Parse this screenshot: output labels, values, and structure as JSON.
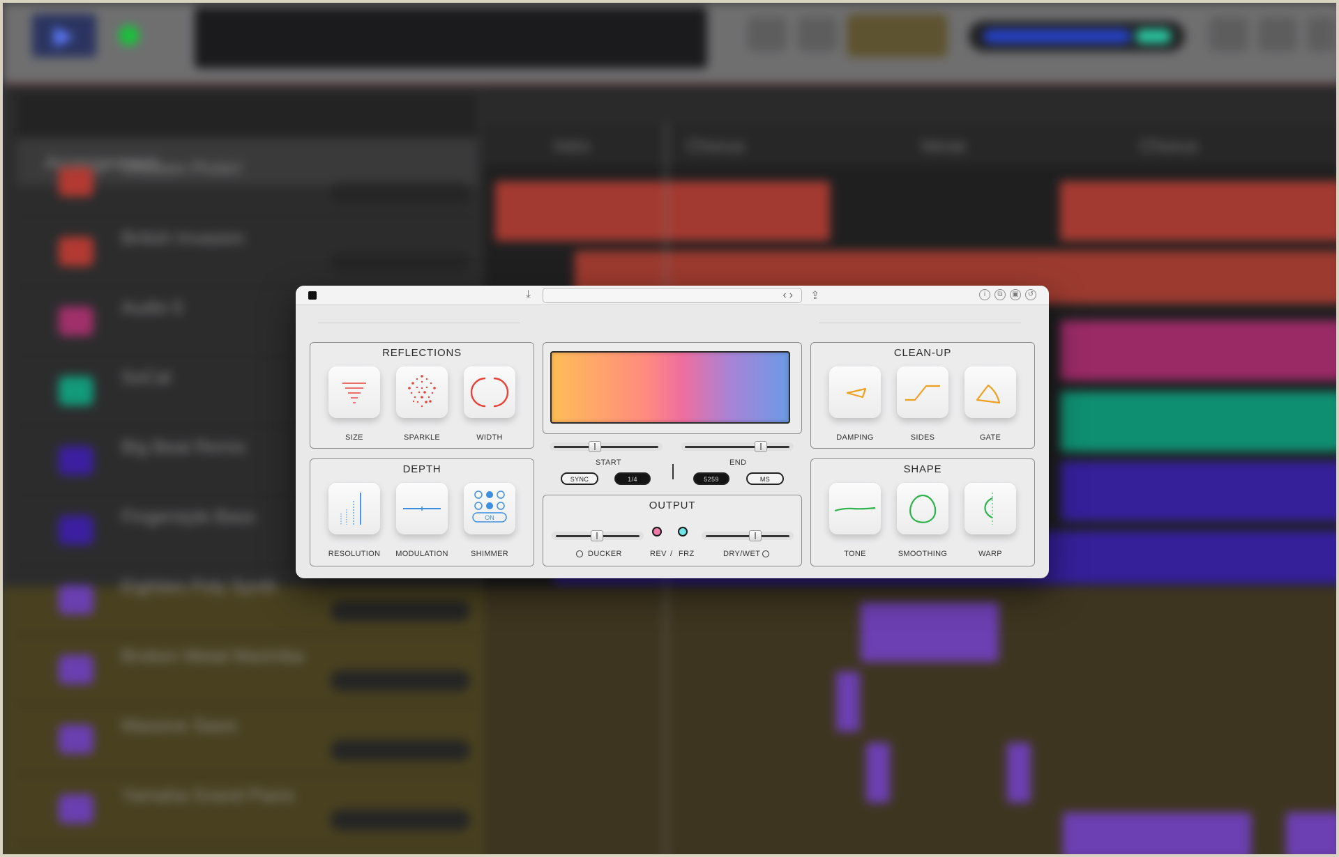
{
  "daw": {
    "arrangement_label": "Arrangement",
    "markers": [
      "Intro",
      "Chorus",
      "Verse",
      "Chorus"
    ],
    "tracks": [
      {
        "name": "Chicken Pickin'",
        "color": "#b23a32"
      },
      {
        "name": "British Invasion",
        "color": "#b23a32"
      },
      {
        "name": "Audio 5",
        "color": "#a0306a"
      },
      {
        "name": "SoCal",
        "color": "#129a7a"
      },
      {
        "name": "Big Beat Remix",
        "color": "#3b1fa0"
      },
      {
        "name": "Fingerstyle Bass",
        "color": "#3b1fa0"
      },
      {
        "name": "Eighties Poly Synth",
        "color": "#6a3fb0"
      },
      {
        "name": "Broken Metal Marimba",
        "color": "#6a3fb0"
      },
      {
        "name": "Massive Saws",
        "color": "#6a3fb0"
      },
      {
        "name": "Yamaha Grand Piano",
        "color": "#6a3fb0"
      }
    ]
  },
  "plugin": {
    "reflections": {
      "title": "REFLECTIONS",
      "knobs": [
        {
          "label": "SIZE",
          "icon": "size-icon"
        },
        {
          "label": "SPARKLE",
          "icon": "sparkle-icon"
        },
        {
          "label": "WIDTH",
          "icon": "width-icon"
        }
      ]
    },
    "depth": {
      "title": "DEPTH",
      "knobs": [
        {
          "label": "RESOLUTION",
          "icon": "resolution-icon"
        },
        {
          "label": "MODULATION",
          "icon": "modulation-icon"
        },
        {
          "label": "SHIMMER",
          "icon": "shimmer-icon",
          "badge": "ON"
        }
      ]
    },
    "cleanup": {
      "title": "CLEAN-UP",
      "knobs": [
        {
          "label": "DAMPING",
          "icon": "damping-icon"
        },
        {
          "label": "SIDES",
          "icon": "sides-icon"
        },
        {
          "label": "GATE",
          "icon": "gate-icon"
        }
      ]
    },
    "shape": {
      "title": "SHAPE",
      "knobs": [
        {
          "label": "TONE",
          "icon": "tone-icon"
        },
        {
          "label": "SMOOTHING",
          "icon": "smoothing-icon"
        },
        {
          "label": "WARP",
          "icon": "warp-icon"
        }
      ]
    },
    "center": {
      "start_label": "START",
      "end_label": "END",
      "sync_label": "SYNC",
      "division_value": "1/4",
      "ms_value": "5259",
      "ms_label": "MS"
    },
    "output": {
      "title": "OUTPUT",
      "ducker_label": "DUCKER",
      "rev_label": "REV",
      "slash": "/",
      "frz_label": "FRZ",
      "drywet_label": "DRY/WET"
    },
    "colors": {
      "accent_red": "#e8433a",
      "accent_blue": "#3b8ee0",
      "accent_orange": "#f0a020",
      "accent_green": "#2bb34a",
      "rev_led": "#f07aa8",
      "frz_led": "#6ce6e6"
    }
  }
}
